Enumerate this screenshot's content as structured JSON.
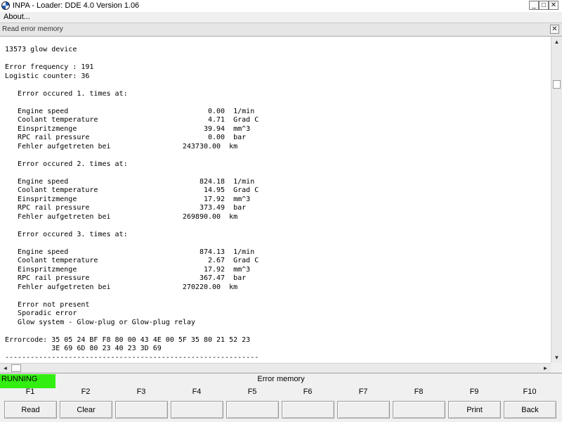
{
  "window": {
    "title": "INPA - Loader:  DDE 4.0 Version 1.06",
    "minimize_glyph": "_",
    "maximize_glyph": "□",
    "close_glyph": "✕"
  },
  "menu": {
    "about": "About..."
  },
  "child_window": {
    "title": "Read error memory",
    "close_glyph": "✕"
  },
  "content": {
    "lines": [
      "13573 glow device",
      "",
      "Error frequency : 191",
      "Logistic counter: 36",
      "",
      "   Error occured 1. times at:",
      "",
      "   Engine speed                                 0.00  1/min",
      "   Coolant temperature                          4.71  Grad C",
      "   Einspritzmenge                              39.94  mm^3",
      "   RPC rail pressure                            0.00  bar",
      "   Fehler aufgetreten bei                 243730.00  km",
      "",
      "   Error occured 2. times at:",
      "",
      "   Engine speed                               824.18  1/min",
      "   Coolant temperature                         14.95  Grad C",
      "   Einspritzmenge                              17.92  mm^3",
      "   RPC rail pressure                          373.49  bar",
      "   Fehler aufgetreten bei                 269890.00  km",
      "",
      "   Error occured 3. times at:",
      "",
      "   Engine speed                               874.13  1/min",
      "   Coolant temperature                          2.67  Grad C",
      "   Einspritzmenge                              17.92  mm^3",
      "   RPC rail pressure                          367.47  bar",
      "   Fehler aufgetreten bei                 270220.00  km",
      "",
      "   Error not present",
      "   Sporadic error",
      "   Glow system - Glow-plug or Glow-plug relay",
      "",
      "Errorcode: 35 05 24 BF F8 80 00 43 4E 00 5F 35 80 21 52 23",
      "           3E 69 6D 80 23 40 23 3D 69",
      "------------------------------------------------------------"
    ]
  },
  "scroll": {
    "up": "▲",
    "down": "▼",
    "left": "◄",
    "right": "►"
  },
  "status": {
    "running": "RUNNING",
    "title": "Error memory"
  },
  "fkeys": [
    {
      "key": "F1",
      "label": "Read"
    },
    {
      "key": "F2",
      "label": "Clear"
    },
    {
      "key": "F3",
      "label": ""
    },
    {
      "key": "F4",
      "label": ""
    },
    {
      "key": "F5",
      "label": ""
    },
    {
      "key": "F6",
      "label": ""
    },
    {
      "key": "F7",
      "label": ""
    },
    {
      "key": "F8",
      "label": ""
    },
    {
      "key": "F9",
      "label": "Print"
    },
    {
      "key": "F10",
      "label": "Back"
    }
  ],
  "colors": {
    "running": "#33ee11",
    "content_bg": "#ffffff",
    "chrome": "#f0f0f0"
  }
}
